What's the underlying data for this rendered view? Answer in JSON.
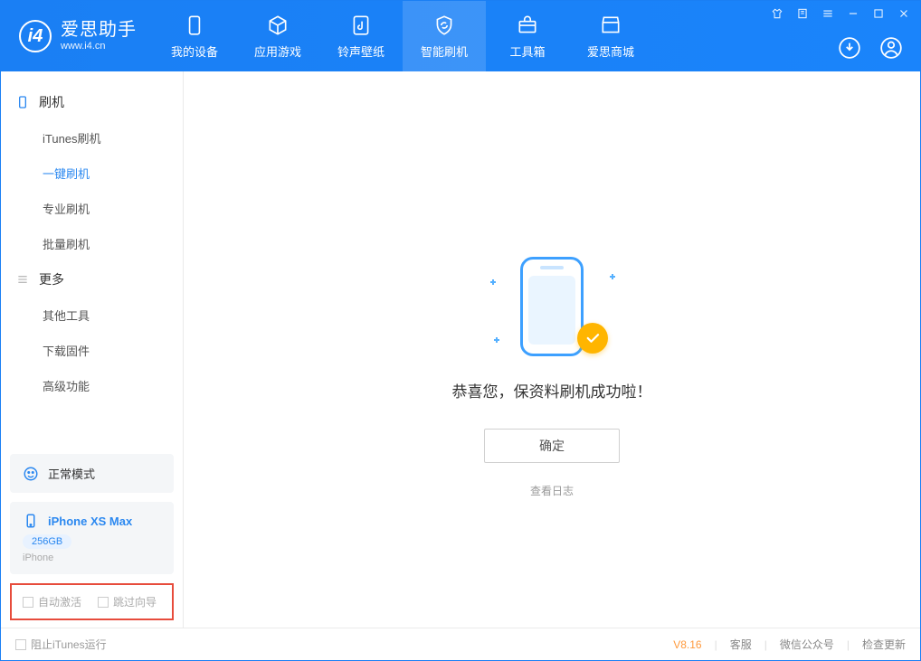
{
  "app": {
    "name_cn": "爱思助手",
    "name_en": "www.i4.cn"
  },
  "header_tabs": [
    {
      "label": "我的设备"
    },
    {
      "label": "应用游戏"
    },
    {
      "label": "铃声壁纸"
    },
    {
      "label": "智能刷机"
    },
    {
      "label": "工具箱"
    },
    {
      "label": "爱思商城"
    }
  ],
  "sidebar": {
    "group1_title": "刷机",
    "group1_items": [
      "iTunes刷机",
      "一键刷机",
      "专业刷机",
      "批量刷机"
    ],
    "group1_active_index": 1,
    "group2_title": "更多",
    "group2_items": [
      "其他工具",
      "下载固件",
      "高级功能"
    ]
  },
  "mode": {
    "label": "正常模式"
  },
  "device": {
    "name": "iPhone XS Max",
    "storage": "256GB",
    "type": "iPhone"
  },
  "options": {
    "auto_activate": "自动激活",
    "skip_guide": "跳过向导"
  },
  "main": {
    "success_text": "恭喜您，保资料刷机成功啦！",
    "ok_button": "确定",
    "view_log": "查看日志"
  },
  "footer": {
    "block_itunes": "阻止iTunes运行",
    "version": "V8.16",
    "support": "客服",
    "wechat": "微信公众号",
    "check_update": "检查更新"
  }
}
